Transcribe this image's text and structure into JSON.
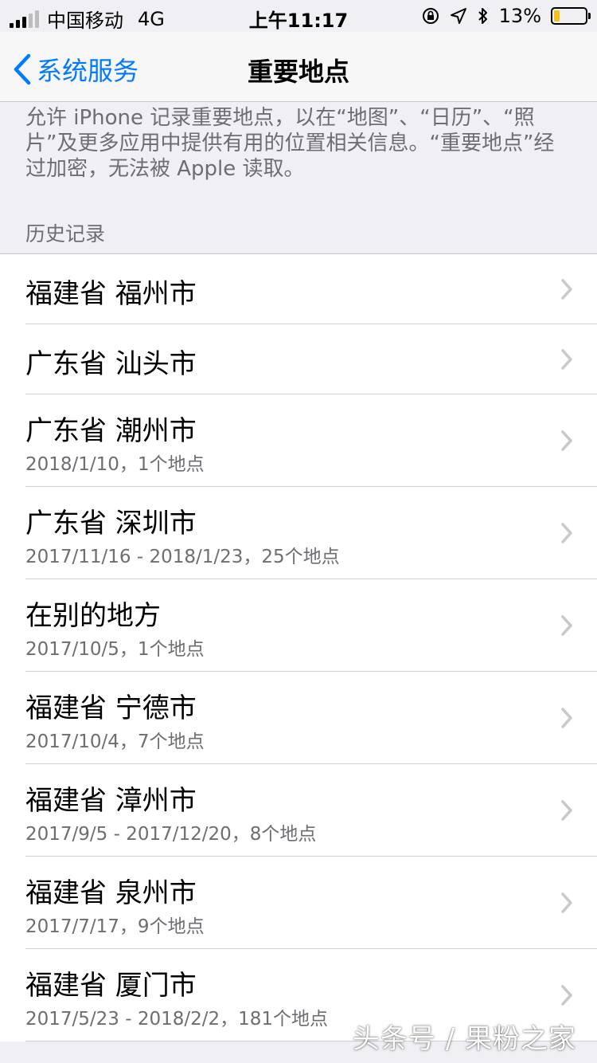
{
  "status_bar": {
    "carrier": "中国移动",
    "network": "4G",
    "time": "上午11:17",
    "battery": "13%",
    "battery_level": 0.13
  },
  "nav": {
    "back_label": "系统服务",
    "title": "重要地点"
  },
  "description": "允许 iPhone 记录重要地点，以在“地图”、“日历”、“照片”及更多应用中提供有用的位置相关信息。“重要地点”经过加密，无法被 Apple 读取。",
  "section_header": "历史记录",
  "rows": [
    {
      "title": "福建省 福州市",
      "subtitle": ""
    },
    {
      "title": "广东省 汕头市",
      "subtitle": ""
    },
    {
      "title": "广东省 潮州市",
      "subtitle": "2018/1/10，1个地点"
    },
    {
      "title": "广东省 深圳市",
      "subtitle": "2017/11/16 - 2018/1/23，25个地点"
    },
    {
      "title": "在别的地方",
      "subtitle": "2017/10/5，1个地点"
    },
    {
      "title": "福建省 宁德市",
      "subtitle": "2017/10/4，7个地点"
    },
    {
      "title": "福建省 漳州市",
      "subtitle": "2017/9/5 - 2017/12/20，8个地点"
    },
    {
      "title": "福建省 泉州市",
      "subtitle": "2017/7/17，9个地点"
    },
    {
      "title": "福建省 厦门市",
      "subtitle": "2017/5/23 - 2018/2/2，181个地点"
    }
  ],
  "watermark": "头条号 / 果粉之家",
  "colors": {
    "accent": "#007aff",
    "battery_fill": "#f2c21b",
    "secondary_text": "#6d6d72"
  }
}
